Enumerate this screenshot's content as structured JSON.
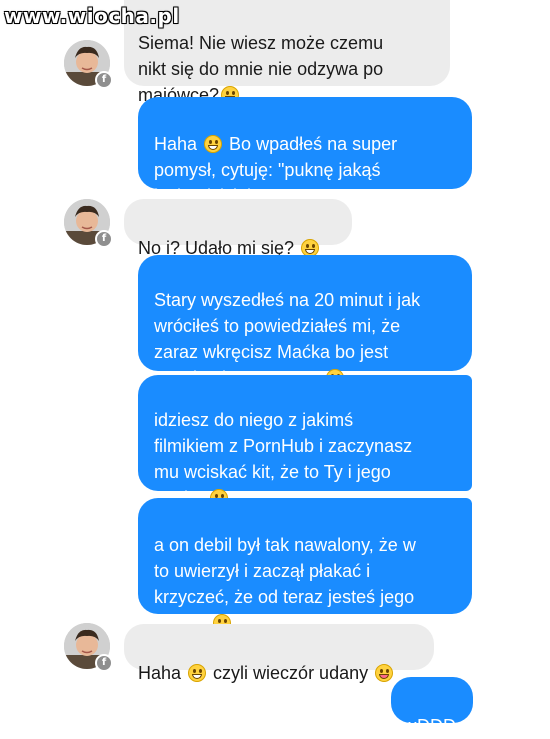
{
  "watermark": "www.wiocha.pl",
  "messages": [
    {
      "from": "contact",
      "text": "Siema! Nie wiesz może czemu\nnikt się do mnie nie odzywa po\nmajówce?",
      "emoji": "grin-icon"
    },
    {
      "from": "me",
      "text": "Haha  Bo wpadłeś na super\npomysł, cytuję: \"puknę jakąś\nlaskę dzisiaj!\"",
      "emoji": "grin-icon"
    },
    {
      "from": "contact",
      "text": "No i? Udało mi się?",
      "emoji": "grin-icon"
    },
    {
      "from": "me",
      "text": "Stary wyszedłeś na 20 minut i jak\nwróciłeś to powiedziałeś mi, że\nzaraz wkręcisz Maćka bo jest\nprawie nieprzytomny",
      "emoji": "grin-icon"
    },
    {
      "from": "me",
      "text": "idziesz do niego z jakimś\nfilmikiem z PornHub i zaczynasz\nmu wciskać kit, że to Ty i jego\nmatka",
      "emoji": "grin-icon"
    },
    {
      "from": "me",
      "text": "a on debil był tak nawalony, że w\nto uwierzył i zaczął płakać i\nkrzyczeć, że od teraz jesteś jego\nOjcem",
      "emoji": "grin-icon"
    },
    {
      "from": "contact",
      "text": "Haha  czyli wieczór udany",
      "emoji": "grin-icon"
    },
    {
      "from": "me",
      "text": "xDDD"
    }
  ],
  "colors": {
    "sent_bubble": "#1a8cff",
    "received_bubble": "#ececec",
    "emoji": "#ffd23f"
  },
  "icons": {
    "avatar": "contact-avatar",
    "badge": "facebook-badge-icon"
  }
}
